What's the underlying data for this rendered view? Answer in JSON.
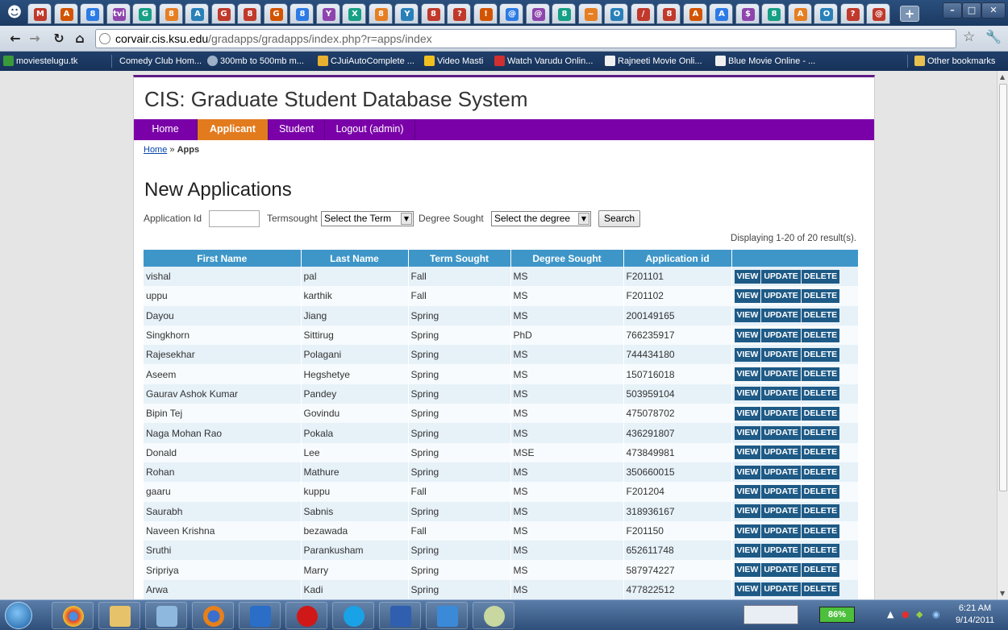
{
  "browser": {
    "url_host": "corvair.cis.ksu.edu",
    "url_path": "/gradapps/gradapps/index.php?r=apps/index",
    "tab_favicons": [
      "M",
      "A",
      "8",
      "tvi",
      "G",
      "8",
      "A",
      "G",
      "8",
      "G",
      "8",
      "Y",
      "X",
      "8",
      "Y",
      "8",
      "?",
      "!",
      "@",
      "@",
      "8",
      "~",
      "O",
      "/",
      "8",
      "A",
      "A",
      "$",
      "8",
      "A",
      "O",
      "?",
      "@"
    ],
    "bookmarks": [
      "moviestelugu.tk",
      "Comedy Club Hom...",
      "300mb to 500mb m...",
      "CJuiAutoComplete ...",
      "Video Masti",
      "Watch Varudu Onlin...",
      "Rajneeti Movie Onli...",
      "Blue Movie Online - ...",
      "Other bookmarks"
    ]
  },
  "site": {
    "title": "CIS: Graduate Student Database System",
    "menu": [
      "Home",
      "Applicant",
      "Student",
      "Logout (admin)"
    ],
    "breadcrumb_home": "Home",
    "breadcrumb_sep": " » ",
    "breadcrumb_current": "Apps"
  },
  "page": {
    "heading": "New Applications",
    "filter": {
      "appid_label": "Application Id",
      "term_label": "Termsought",
      "term_select": "Select the Term",
      "degree_label": "Degree Sought",
      "degree_select": "Select the degree",
      "search_label": "Search"
    },
    "summary": "Displaying 1-20 of 20 result(s).",
    "columns": [
      "First Name",
      "Last Name",
      "Term Sought",
      "Degree Sought",
      "Application id",
      ""
    ],
    "actions": [
      "VIEW",
      "UPDATE",
      "DELETE"
    ],
    "rows": [
      [
        "vishal",
        "pal",
        "Fall",
        "MS",
        "F201101"
      ],
      [
        "uppu",
        "karthik",
        "Fall",
        "MS",
        "F201102"
      ],
      [
        "Dayou",
        "Jiang",
        "Spring",
        "MS",
        "200149165"
      ],
      [
        "Singkhorn",
        "Sittirug",
        "Spring",
        "PhD",
        "766235917"
      ],
      [
        "Rajesekhar",
        "Polagani",
        "Spring",
        "MS",
        "744434180"
      ],
      [
        "Aseem",
        "Hegshetye",
        "Spring",
        "MS",
        "150716018"
      ],
      [
        "Gaurav Ashok Kumar",
        "Pandey",
        "Spring",
        "MS",
        "503959104"
      ],
      [
        "Bipin Tej",
        "Govindu",
        "Spring",
        "MS",
        "475078702"
      ],
      [
        "Naga Mohan Rao",
        "Pokala",
        "Spring",
        "MS",
        "436291807"
      ],
      [
        "Donald",
        "Lee",
        "Spring",
        "MSE",
        "473849981"
      ],
      [
        "Rohan",
        "Mathure",
        "Spring",
        "MS",
        "350660015"
      ],
      [
        "gaaru",
        "kuppu",
        "Fall",
        "MS",
        "F201204"
      ],
      [
        "Saurabh",
        "Sabnis",
        "Spring",
        "MS",
        "318936167"
      ],
      [
        "Naveen Krishna",
        "bezawada",
        "Fall",
        "MS",
        "F201150"
      ],
      [
        "Sruthi",
        "Parankusham",
        "Spring",
        "MS",
        "652611748"
      ],
      [
        "Sripriya",
        "Marry",
        "Spring",
        "MS",
        "587974227"
      ],
      [
        "Arwa",
        "Kadi",
        "Spring",
        "MS",
        "477822512"
      ]
    ]
  },
  "taskbar": {
    "battery": "86%",
    "time": "6:21 AM",
    "date": "9/14/2011"
  },
  "colors": {
    "menu_bg": "#7a00a8",
    "menu_active": "#e27b1e",
    "grid_header": "#3e96c8",
    "action_button": "#1e5a86"
  }
}
